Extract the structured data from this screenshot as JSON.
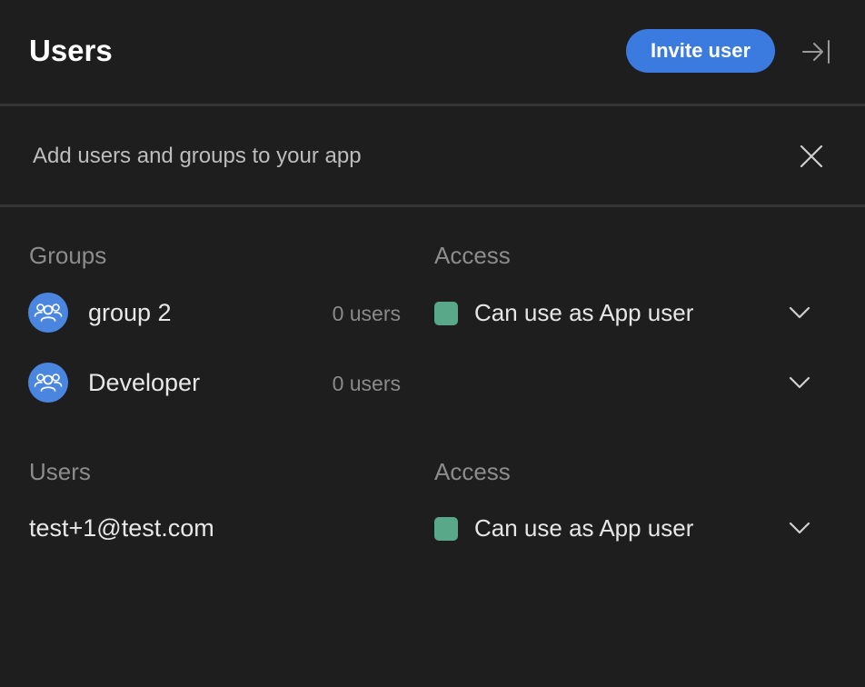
{
  "header": {
    "title": "Users",
    "invite_label": "Invite user"
  },
  "banner": {
    "text": "Add users and groups to your app"
  },
  "groups_section": {
    "heading": "Groups",
    "access_heading": "Access",
    "rows": [
      {
        "name": "group 2",
        "count": "0 users",
        "access": "Can use as App user"
      },
      {
        "name": "Developer",
        "count": "0 users",
        "access": ""
      }
    ]
  },
  "users_section": {
    "heading": "Users",
    "access_heading": "Access",
    "rows": [
      {
        "email": "test+1@test.com",
        "access": "Can use as App user"
      }
    ]
  },
  "colors": {
    "background": "#1e1e1e",
    "accent": "#3b7be0",
    "avatar": "#4a86e0",
    "access_chip": "#5aa88a"
  },
  "icons": {
    "collapse": "collapse-right-icon",
    "close": "close-icon",
    "group": "group-icon",
    "chevron": "chevron-down-icon"
  }
}
